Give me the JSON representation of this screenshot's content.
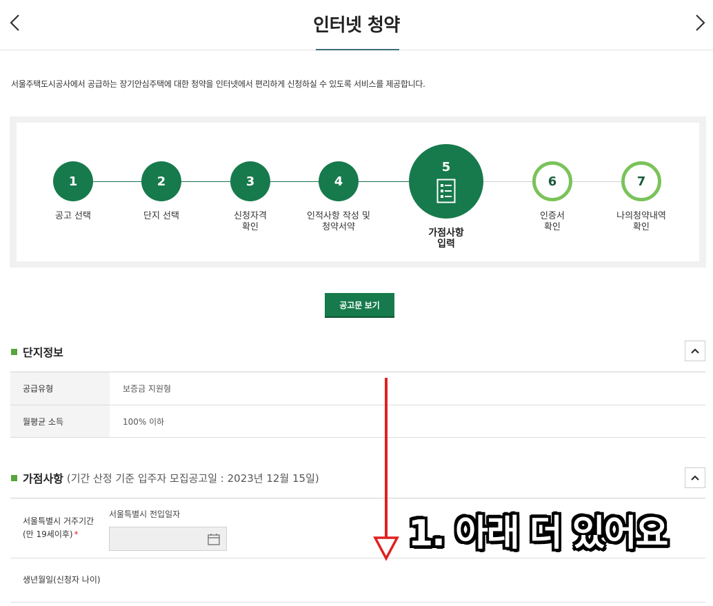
{
  "header": {
    "title": "인터넷 청약",
    "prev_icon": "chevron-left-icon",
    "next_icon": "chevron-right-icon"
  },
  "intro": "서울주택도시공사에서 공급하는 장기안심주택에 대한 청약을 인터넷에서 편리하게 신청하실 수 있도록 서비스를 제공합니다.",
  "steps": [
    {
      "num": "1",
      "label": "공고 선택",
      "state": "done"
    },
    {
      "num": "2",
      "label": "단지 선택",
      "state": "done"
    },
    {
      "num": "3",
      "label": "신청자격\n확인",
      "state": "done"
    },
    {
      "num": "4",
      "label": "인적사항 작성 및\n청약서약",
      "state": "done"
    },
    {
      "num": "5",
      "label": "가점사항\n입력",
      "state": "active",
      "icon": "checklist-icon"
    },
    {
      "num": "6",
      "label": "인증서\n확인",
      "state": "todo"
    },
    {
      "num": "7",
      "label": "나의청약내역\n확인",
      "state": "todo"
    }
  ],
  "notice_button": "공고문 보기",
  "complex_info": {
    "title": "단지정보",
    "rows": [
      {
        "label": "공급유형",
        "value": "보증금 지원형"
      },
      {
        "label": "월평균 소득",
        "value": "100% 이하"
      }
    ]
  },
  "points": {
    "title": "가점사항",
    "subtitle": "(기간 산정 기준 입주자 모집공고일 : 2023년 12월 15일)",
    "rows": [
      {
        "label": "서울특별시 거주기간 (만 19세이후)",
        "required": "*",
        "caption": "서울특별시 전입일자",
        "value": ""
      },
      {
        "label": "생년월일(신청자 나이)"
      }
    ]
  },
  "annotation": {
    "text": "1. 아래 더 있어요",
    "color": "#e02020"
  },
  "colors": {
    "primary": "#177a4c",
    "accent": "#7ac35a"
  }
}
